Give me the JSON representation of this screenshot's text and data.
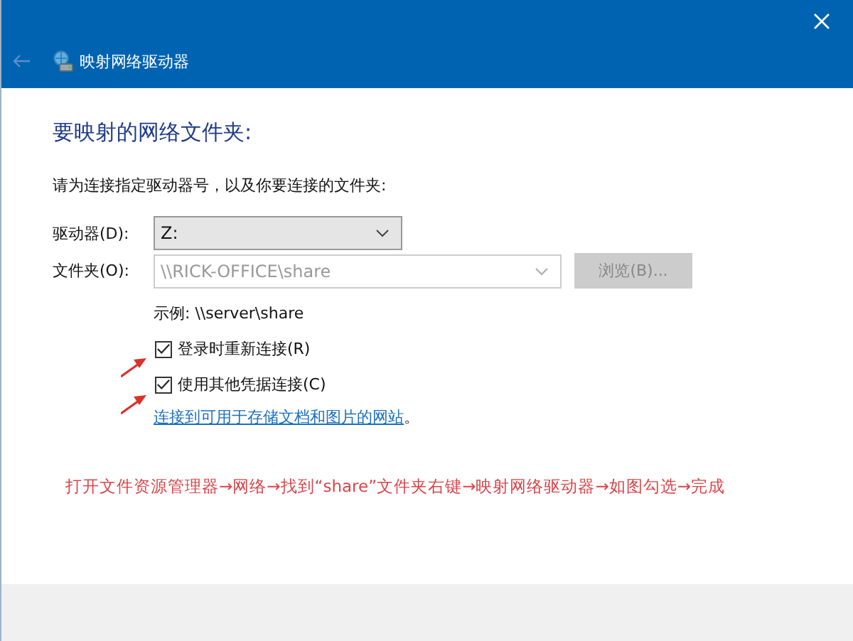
{
  "window": {
    "title": "映射网络驱动器"
  },
  "heading": "要映射的网络文件夹:",
  "instruction": "请为连接指定驱动器号，以及你要连接的文件夹:",
  "drive": {
    "label": "驱动器(D):",
    "value": "Z:",
    "disabled": false
  },
  "folder": {
    "label": "文件夹(O):",
    "value": "\\\\RICK-OFFICE\\share",
    "disabled": true
  },
  "browse_button": {
    "label": "浏览(B)...",
    "disabled": true
  },
  "example": "示例: \\\\server\\share",
  "options": [
    {
      "label": "登录时重新连接(R)",
      "checked": true
    },
    {
      "label": "使用其他凭据连接(C)",
      "checked": true
    }
  ],
  "link": "连接到可用于存储文档和图片的网站",
  "link_suffix": "。",
  "annotation": "打开文件资源管理器→网络→找到“share”文件夹右键→映射网络驱动器→如图勾选→完成"
}
